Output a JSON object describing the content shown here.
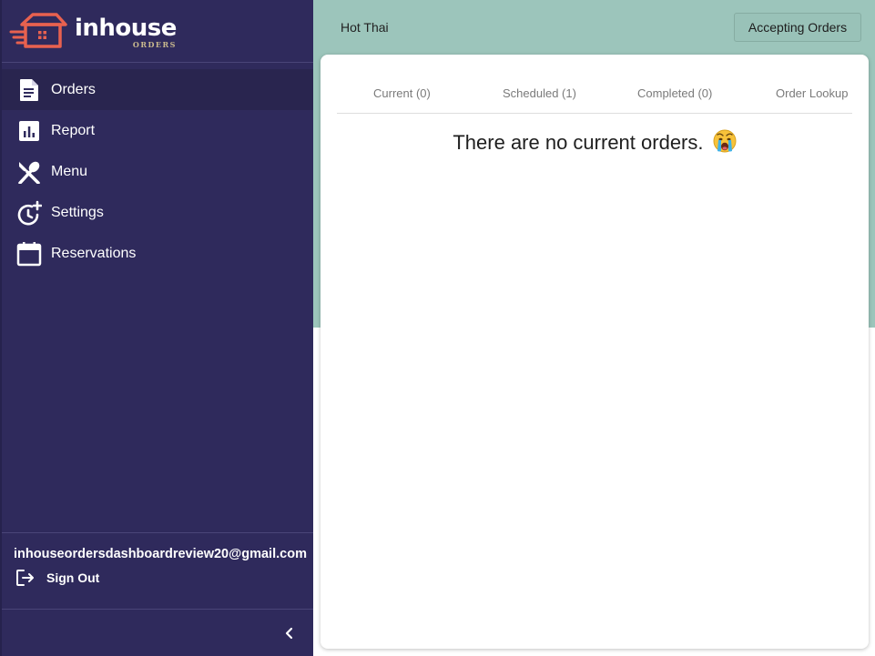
{
  "brand": {
    "name": "inhouse",
    "sub": "ORDERS"
  },
  "sidebar": {
    "items": [
      {
        "label": "Orders",
        "icon": "document-icon",
        "active": true
      },
      {
        "label": "Report",
        "icon": "bar-chart-icon"
      },
      {
        "label": "Menu",
        "icon": "utensils-icon"
      },
      {
        "label": "Settings",
        "icon": "clock-plus-icon"
      },
      {
        "label": "Reservations",
        "icon": "calendar-icon"
      }
    ],
    "email": "inhouseordersdashboardreview20@gmail.com",
    "signout_label": "Sign Out"
  },
  "header": {
    "restaurant": "Hot Thai",
    "status_button": "Accepting Orders"
  },
  "tabs": [
    {
      "label": "Current (0)"
    },
    {
      "label": "Scheduled (1)"
    },
    {
      "label": "Completed (0)"
    },
    {
      "label": "Order Lookup"
    }
  ],
  "empty_message": "There are no current orders.",
  "colors": {
    "sidebar_bg": "#2f2a5c",
    "header_bg": "#9cc5bb",
    "logo_accent": "#e8614f"
  }
}
